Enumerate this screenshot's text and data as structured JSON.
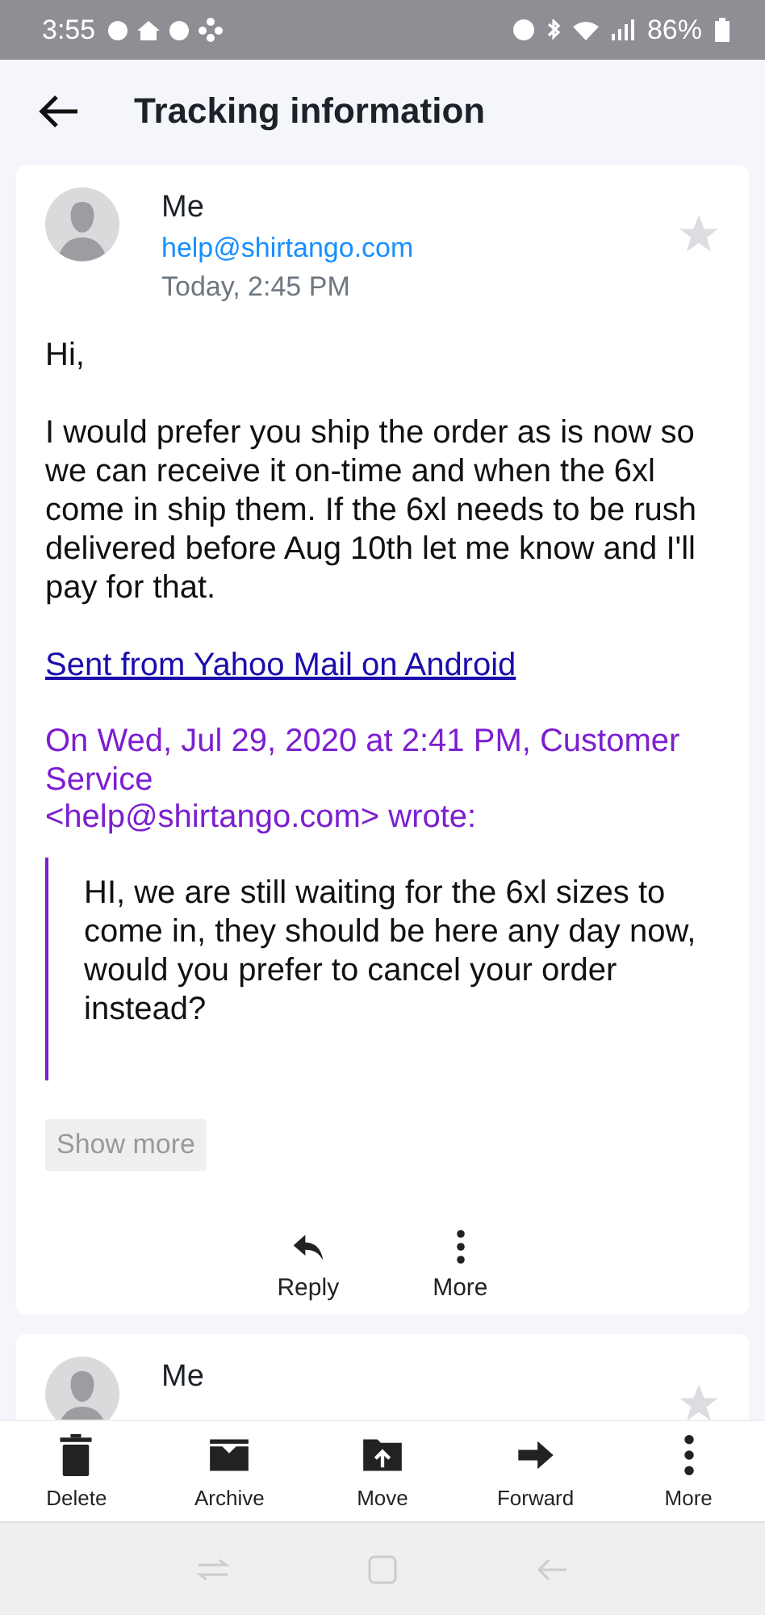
{
  "status_bar": {
    "time": "3:55",
    "battery": "86%"
  },
  "header": {
    "title": "Tracking information"
  },
  "messages": [
    {
      "sender": "Me",
      "address": "help@shirtango.com",
      "date": "Today, 2:45 PM",
      "starred": false,
      "body": [
        "Hi,",
        "I would prefer you ship the order as is now so we can receive it on-time and when the 6xl come in ship them. If the 6xl needs to be rush delivered before Aug 10th let me know and I'll pay for that."
      ],
      "signature_link": "Sent from Yahoo Mail on Android",
      "quote_header": [
        "On Wed, Jul 29, 2020 at 2:41 PM, Customer Service",
        "<help@shirtango.com> wrote:"
      ],
      "quote": "HI, we are still waiting for the 6xl sizes to come in, they should be here any day now, would you prefer to cancel your order instead?",
      "show_more": "Show more",
      "actions": [
        {
          "label": "Reply"
        },
        {
          "label": "More"
        }
      ]
    },
    {
      "sender": "Me",
      "starred": false
    }
  ],
  "toolbar": [
    {
      "label": "Delete"
    },
    {
      "label": "Archive"
    },
    {
      "label": "Move"
    },
    {
      "label": "Forward"
    },
    {
      "label": "More"
    }
  ]
}
